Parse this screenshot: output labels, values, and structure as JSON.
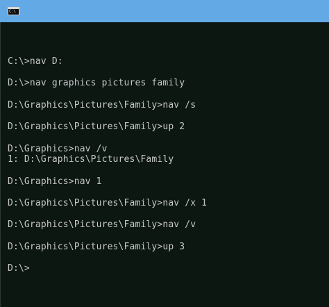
{
  "window": {
    "icon": "cmd-icon",
    "icon_label": "C:\\",
    "titlebar_color": "#63a9e6",
    "console_bg": "#0c1712",
    "text_color": "#c8c8c8"
  },
  "console": {
    "lines": [
      "C:\\>nav D:",
      "",
      "D:\\>nav graphics pictures family",
      "",
      "D:\\Graphics\\Pictures\\Family>nav /s",
      "",
      "D:\\Graphics\\Pictures\\Family>up 2",
      "",
      "D:\\Graphics>nav /v",
      "1: D:\\Graphics\\Pictures\\Family",
      "",
      "D:\\Graphics>nav 1",
      "",
      "D:\\Graphics\\Pictures\\Family>nav /x 1",
      "",
      "D:\\Graphics\\Pictures\\Family>nav /v",
      "",
      "D:\\Graphics\\Pictures\\Family>up 3",
      "",
      "D:\\>"
    ]
  }
}
